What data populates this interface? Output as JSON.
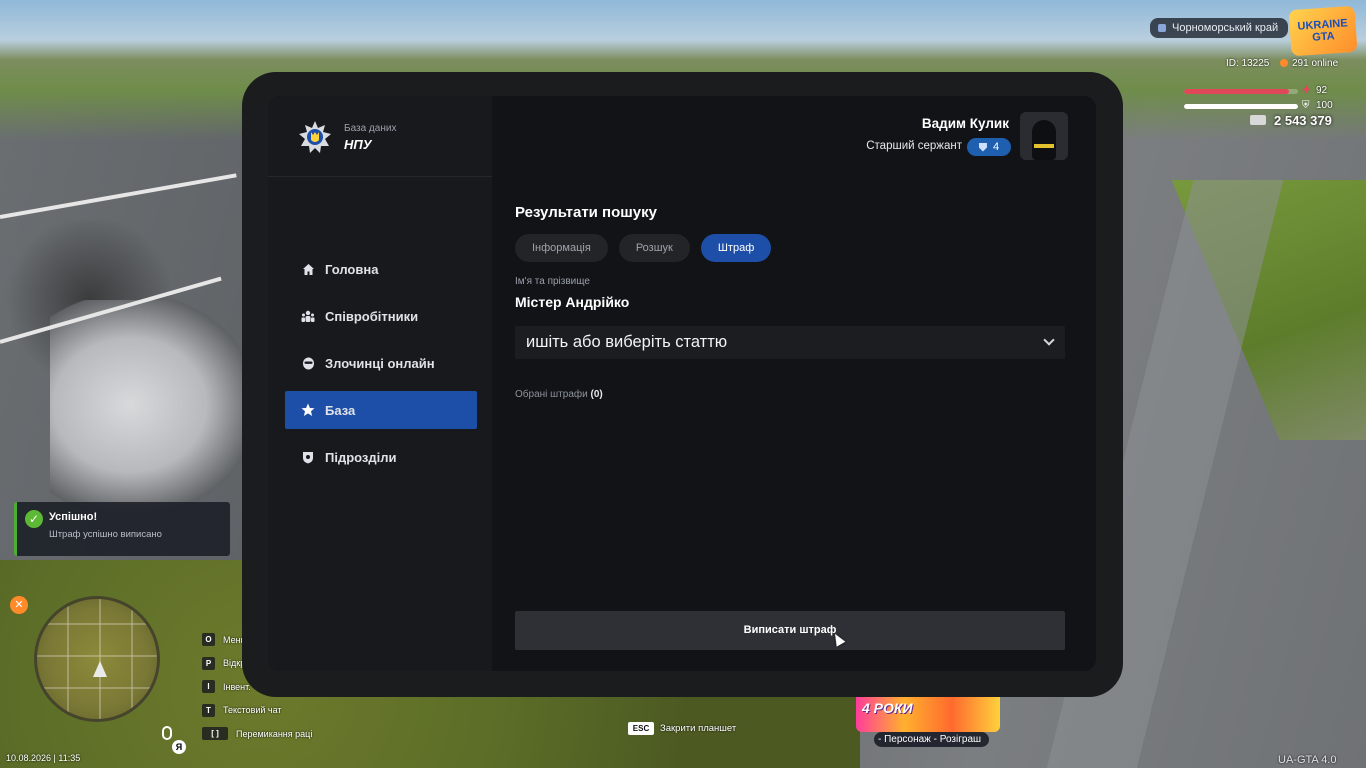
{
  "hud": {
    "region": "Чорноморський край",
    "logo_line1": "UKRAINE",
    "logo_line2": "GTA",
    "player_id": "ID: 13225",
    "online": "291 online",
    "health_value": "92",
    "health_level": 0.92,
    "armor_value": "100",
    "armor_level": 1.0,
    "money": "2 543 379",
    "health_color": "#e0485a",
    "armor_color": "#ffffff"
  },
  "toast": {
    "title": "Успішно!",
    "text": "Штраф успішно виписано"
  },
  "keybinds": [
    {
      "key": "O",
      "label": "Меню"
    },
    {
      "key": "P",
      "label": "Відкр."
    },
    {
      "key": "I",
      "label": "Інвент."
    },
    {
      "key": "T",
      "label": "Текстовий чат"
    },
    {
      "key": "[  ]",
      "label": "Перемикання раці"
    }
  ],
  "date": "10.08.2026 | 11:35",
  "lang": "Я",
  "esc": {
    "key": "ESC",
    "label": "Закрити планшет"
  },
  "promo": {
    "text": "4 РОКИ",
    "caption": "- Персонаж - Розіграш"
  },
  "version": "UA-GTA 4.0",
  "tablet": {
    "brand_sub": "База даних",
    "brand_title": "НПУ",
    "accent": "#1d4fa8",
    "nav": [
      {
        "label": "Головна",
        "icon": "home-icon",
        "active": false
      },
      {
        "label": "Співробітники",
        "icon": "users-icon",
        "active": false
      },
      {
        "label": "Злочинці онлайн",
        "icon": "mask-icon",
        "active": false
      },
      {
        "label": "База",
        "icon": "star-icon",
        "active": true
      },
      {
        "label": "Підрозділи",
        "icon": "shield-icon",
        "active": false
      }
    ],
    "user": {
      "name": "Вадим Кулик",
      "rank": "Старший сержант",
      "rank_level": "4"
    },
    "main": {
      "section_title": "Результати пошуку",
      "tabs": [
        {
          "label": "Інформація",
          "active": false
        },
        {
          "label": "Розшук",
          "active": false
        },
        {
          "label": "Штраф",
          "active": true
        }
      ],
      "name_label": "Ім'я та прізвище",
      "name_value": "Містер Андрійко",
      "select_text": "ишіть або виберіть статтю",
      "selected_label": "Обрані штрафи",
      "selected_count": "(0)",
      "submit_label": "Виписати штраф"
    }
  }
}
